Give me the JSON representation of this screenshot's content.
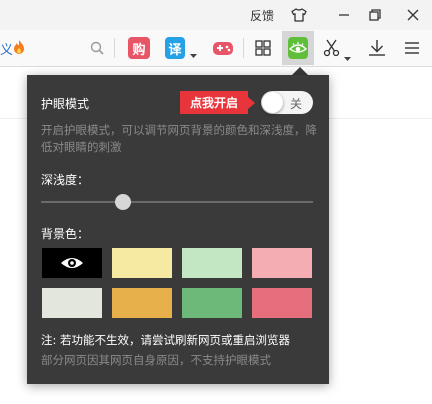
{
  "titlebar": {
    "feedback_label": "反馈",
    "skin_icon": "tshirt-icon",
    "min_icon": "minimize-icon",
    "max_icon": "restore-icon",
    "close_icon": "close-icon"
  },
  "toolbar": {
    "address_tail": "义",
    "shop_label": "购",
    "translate_label": "译",
    "icons": [
      "fire-icon",
      "search-icon",
      "game-icon",
      "apps-grid-icon",
      "eye-protection-icon",
      "scissors-icon",
      "download-icon",
      "menu-icon"
    ]
  },
  "popup": {
    "title": "护眼模式",
    "callout": "点我开启",
    "toggle_text": "关",
    "toggle_on": false,
    "description": "开启护眼模式，可以调节网页背景的颜色和深浅度，降低对眼睛的刺激",
    "depth_label": "深浅度：",
    "depth_value": 0.3,
    "bg_label": "背景色：",
    "swatch_colors": [
      "#000000",
      "#f6e9a1",
      "#c3e6c3",
      "#f4adb3",
      "#e3e6dd",
      "#e7b04a",
      "#6cb97a",
      "#e56f7d"
    ],
    "selected_swatch": 0,
    "note": "注: 若功能不生效，请尝试刷新网页或重启浏览器",
    "note2": "部分网页因其网页自身原因，不支持护眼模式"
  },
  "colors": {
    "popup_bg": "#3a3a3a",
    "accent_red": "#e8343b",
    "eye_green": "#5fbf3b"
  }
}
